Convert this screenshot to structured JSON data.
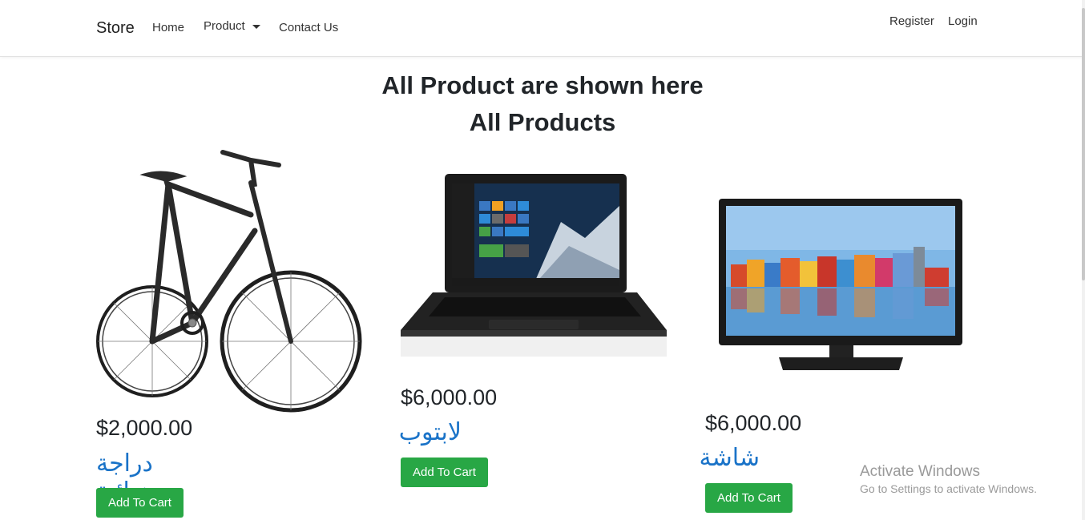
{
  "nav": {
    "brand": "Store",
    "home": "Home",
    "product": "Product",
    "contact": "Contact Us",
    "register": "Register",
    "login": "Login"
  },
  "page": {
    "heading": "All Product are shown here",
    "subheading": "All Products"
  },
  "products": [
    {
      "price": "$2,000.00",
      "name": "دراجة هوائية",
      "button": "Add To Cart",
      "image": "bicycle"
    },
    {
      "price": "$6,000.00",
      "name": "لابتوب",
      "button": "Add To Cart",
      "image": "laptop"
    },
    {
      "price": "$6,000.00",
      "name": "شاشة",
      "button": "Add To Cart",
      "image": "monitor"
    }
  ],
  "watermark": {
    "title": "Activate Windows",
    "subtitle": "Go to Settings to activate Windows."
  },
  "colors": {
    "accent_button": "#28a745",
    "product_name": "#1a73c8"
  }
}
